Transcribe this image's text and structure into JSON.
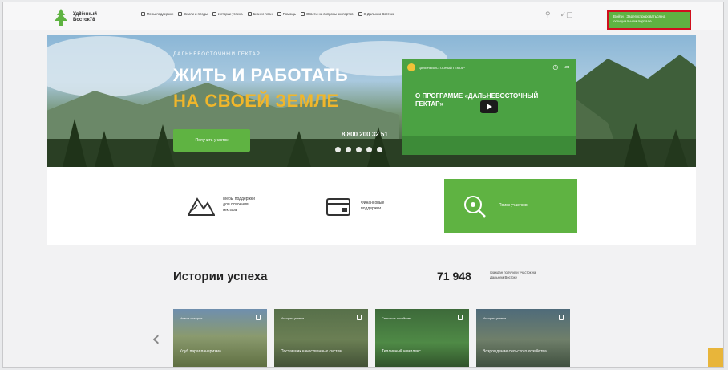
{
  "header": {
    "logo_text": "Уд8ённый Восток78",
    "nav": [
      {
        "label": "Меры поддержки",
        "icon": "support-icon"
      },
      {
        "label": "Земли и плоды",
        "icon": "land-icon"
      },
      {
        "label": "Истории успеха",
        "icon": "stories-icon"
      },
      {
        "label": "Бизнес план",
        "icon": "business-icon"
      },
      {
        "label": "Помощь",
        "icon": "help-icon"
      },
      {
        "label": "Ответы на вопросы экспертов",
        "icon": "faq-icon"
      },
      {
        "label": "О Дальнем Востоке",
        "icon": "info-icon"
      }
    ],
    "cta_label": "Войти / Зарегистрироваться на официальном портале"
  },
  "hero": {
    "subtitle": "ДАЛЬНЕВОСТОЧНЫЙ ГЕКТАР",
    "title_line1": "ЖИТЬ И РАБОТАТЬ",
    "title_line2": "НА СВОЕЙ ЗЕМЛЕ",
    "button_label": "Получить участок",
    "phone": "8 800 200 32 51",
    "video": {
      "channel": "ДАЛЬНЕВОСТОЧНЫЙ ГЕКТАР",
      "title": "О ПРОГРАММЕ «ДАЛЬНЕВОСТОЧНЫЙ ГЕКТАР»"
    }
  },
  "features": [
    {
      "label": "Меры поддержки для освоения гектара",
      "icon": "mountains-icon"
    },
    {
      "label": "Финансовые поддержки",
      "icon": "card-icon"
    },
    {
      "label": "Поиск участков",
      "icon": "map-search-icon"
    }
  ],
  "stories": {
    "title": "Истории успеха",
    "count": "71 948",
    "count_desc": "граждан получили участок на Дальнем Востоке",
    "cards": [
      {
        "tag": "Новые истории",
        "caption": "Клуб парапланеризма"
      },
      {
        "tag": "Истории успеха",
        "caption": "Поставщик качественных систем"
      },
      {
        "tag": "Сельское хозяйство",
        "caption": "Тепличный комплекс"
      },
      {
        "tag": "Истории успеха",
        "caption": "Возрождение сельского хозяйства"
      }
    ]
  },
  "colors": {
    "accent": "#5fb342",
    "highlight": "#f0b62b",
    "cta_border": "#d0101e"
  }
}
